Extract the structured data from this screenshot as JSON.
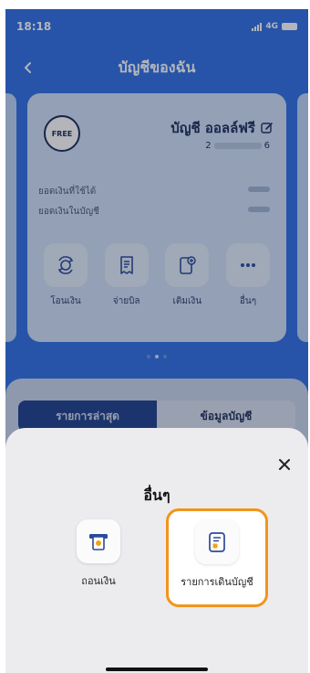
{
  "status_bar": {
    "time": "18:18",
    "network": "4G"
  },
  "header": {
    "title": "บัญชีของฉัน",
    "back_icon": "chevron-left-icon"
  },
  "account_card": {
    "badge": "FREE",
    "name": "บัญชี ออลล์ฟรี",
    "number_prefix": "2",
    "number_suffix": "6",
    "available_balance_label": "ยอดเงินที่ใช้ได้",
    "account_balance_label": "ยอดเงินในบัญชี",
    "actions": [
      {
        "label": "โอนเงิน",
        "icon": "transfer-icon"
      },
      {
        "label": "จ่ายบิล",
        "icon": "bill-icon"
      },
      {
        "label": "เติมเงิน",
        "icon": "topup-icon"
      },
      {
        "label": "อื่นๆ",
        "icon": "more-icon"
      }
    ]
  },
  "tabs": [
    {
      "label": "รายการล่าสุด",
      "active": true
    },
    {
      "label": "ข้อมูลบัญชี",
      "active": false
    }
  ],
  "sheet": {
    "title": "อื่นๆ",
    "close_icon": "close-icon",
    "options": [
      {
        "label": "ถอนเงิน",
        "icon": "cash-withdraw-icon",
        "highlighted": false
      },
      {
        "label": "รายการเดินบัญชี",
        "icon": "statement-icon",
        "highlighted": true
      }
    ]
  },
  "colors": {
    "brand_blue": "#2f6fe6",
    "accent_orange": "#f2951c",
    "tab_active": "#1e3f8c"
  }
}
